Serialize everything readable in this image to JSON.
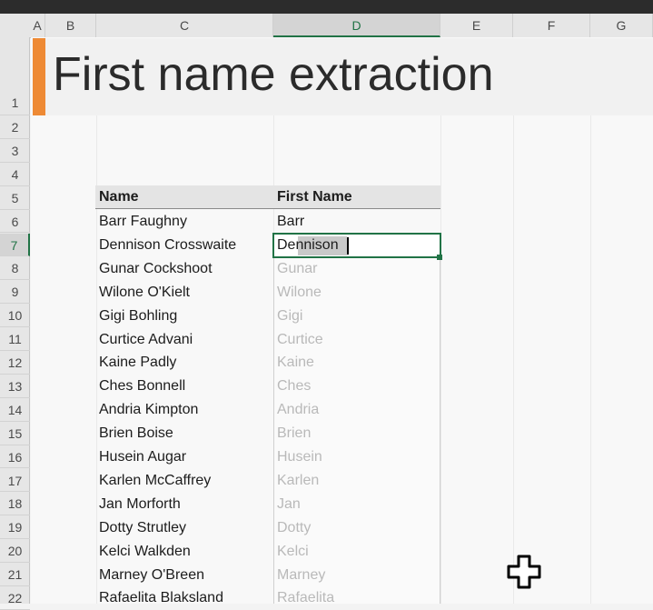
{
  "top_strip_text": "",
  "columns": [
    "A",
    "B",
    "C",
    "D",
    "E",
    "F",
    "G"
  ],
  "selected_column": "D",
  "rows": [
    "1",
    "2",
    "3",
    "4",
    "5",
    "6",
    "7",
    "8",
    "9",
    "10",
    "11",
    "12",
    "13",
    "14",
    "15",
    "16",
    "17",
    "18",
    "19",
    "20",
    "21",
    "22"
  ],
  "selected_row": "7",
  "title": "First name extraction",
  "table": {
    "headers": [
      "Name",
      "First Name"
    ],
    "names": [
      "Barr Faughny",
      "Dennison Crosswaite",
      "Gunar Cockshoot",
      "Wilone O'Kielt",
      "Gigi Bohling",
      "Curtice Advani",
      "Kaine Padly",
      "Ches Bonnell",
      "Andria Kimpton",
      "Brien Boise",
      "Husein Augar",
      "Karlen McCaffrey",
      "Jan Morforth",
      "Dotty Strutley",
      "Kelci Walkden",
      "Marney O'Breen",
      "Rafaelita Blaksland"
    ],
    "first_names_entered": [
      "Barr",
      "Dennison"
    ],
    "flash_fill_suggestions": [
      "Gunar",
      "Wilone",
      "Gigi",
      "Curtice",
      "Kaine",
      "Ches",
      "Andria",
      "Brien",
      "Husein",
      "Karlen",
      "Jan",
      "Dotty",
      "Kelci",
      "Marney",
      "Rafaelita"
    ]
  },
  "icons": {
    "cursor": "cross-cursor-icon"
  },
  "colors": {
    "accent": "#217346",
    "title_bar": "#ee8a35"
  }
}
